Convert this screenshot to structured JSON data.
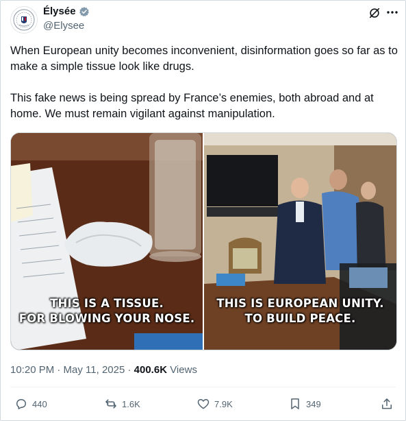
{
  "author": {
    "name": "Élysée",
    "handle": "@Elysee"
  },
  "tweet": {
    "paragraph1": "When European unity becomes inconvenient, disinformation goes so far as to make a simple tissue look like drugs.",
    "paragraph2": "This fake news is being spread by France’s enemies, both abroad and at home. We must remain vigilant against manipulation."
  },
  "media": {
    "left_caption_line1": "THIS IS A TISSUE.",
    "left_caption_line2": "FOR BLOWING YOUR NOSE.",
    "right_caption_line1": "THIS IS EUROPEAN UNITY.",
    "right_caption_line2": "TO BUILD PEACE."
  },
  "meta": {
    "timestamp": "10:20 PM · May 11, 2025 · ",
    "views_count": "400.6K",
    "views_label": " Views"
  },
  "actions": {
    "replies": "440",
    "reposts": "1.6K",
    "likes": "7.9K",
    "bookmarks": "349"
  },
  "colors": {
    "text": "#0f1419",
    "secondary": "#536471",
    "verified": "#829aab",
    "border": "#cfd9de"
  },
  "icons": [
    "elysee-seal-icon",
    "verified-badge-icon",
    "grok-icon",
    "more-icon",
    "reply-icon",
    "repost-icon",
    "like-icon",
    "bookmark-icon",
    "share-icon"
  ]
}
